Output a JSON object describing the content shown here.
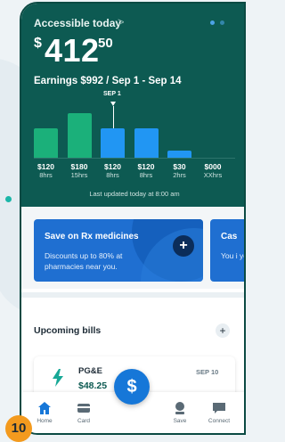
{
  "header": {
    "title": "Accessible today",
    "chevron": ">",
    "page_dots": [
      "active",
      "inactive"
    ]
  },
  "balance": {
    "currency": "$",
    "dollars": "412",
    "cents": "50"
  },
  "earnings_line": "Earnings $992 / Sep 1 - Sep 14",
  "chart_data": {
    "type": "bar",
    "marker_label": "SEP 1",
    "bars": [
      {
        "value_label": "$120",
        "hours_label": "8hrs",
        "value": 120,
        "color": "#1bb07a"
      },
      {
        "value_label": "$180",
        "hours_label": "15hrs",
        "value": 180,
        "color": "#1bb07a"
      },
      {
        "value_label": "$120",
        "hours_label": "8hrs",
        "value": 120,
        "color": "#2196f3"
      },
      {
        "value_label": "$120",
        "hours_label": "8hrs",
        "value": 120,
        "color": "#2196f3"
      },
      {
        "value_label": "$30",
        "hours_label": "2hrs",
        "value": 30,
        "color": "#2196f3"
      },
      {
        "value_label": "$000",
        "hours_label": "XXhrs",
        "value": 0,
        "color": "#2196f3"
      }
    ]
  },
  "last_updated": "Last updated today at 8:00 am",
  "promos": [
    {
      "title": "Save on Rx medicines",
      "body": "Discounts up to 80% at pharmacies near you."
    },
    {
      "title": "Cas",
      "body": "You i your"
    }
  ],
  "bills": {
    "title": "Upcoming bills",
    "add": "+",
    "items": [
      {
        "name": "PG&E",
        "amount": "$48.25",
        "date": "SEP 10"
      }
    ]
  },
  "tabs": [
    {
      "label": "Home",
      "icon": "home-icon"
    },
    {
      "label": "Card",
      "icon": "card-icon"
    },
    {
      "label": "Save",
      "icon": "save-icon"
    },
    {
      "label": "Connect",
      "icon": "chat-icon"
    }
  ],
  "fab_symbol": "$",
  "step_badge": "10",
  "colors": {
    "hero_bg": "#0d5a52",
    "accent_blue": "#1677d8",
    "green_bar": "#1bb07a",
    "blue_bar": "#2196f3"
  }
}
